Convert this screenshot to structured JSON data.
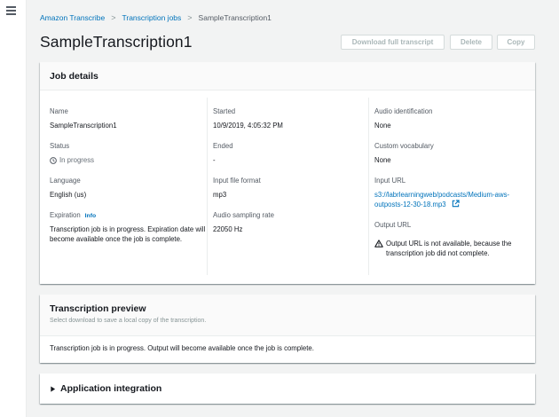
{
  "breadcrumb": {
    "items": [
      "Amazon Transcribe",
      "Transcription jobs"
    ],
    "current": "SampleTranscription1",
    "separator": ">"
  },
  "page": {
    "title": "SampleTranscription1"
  },
  "actions": {
    "download": "Download full transcript",
    "delete": "Delete",
    "copy": "Copy"
  },
  "job_details": {
    "heading": "Job details",
    "name": {
      "label": "Name",
      "value": "SampleTranscription1"
    },
    "status": {
      "label": "Status",
      "value": "In progress"
    },
    "language": {
      "label": "Language",
      "value": "English (us)"
    },
    "expiration": {
      "label": "Expiration",
      "info": "Info",
      "value": "Transcription job is in progress. Expiration date will become available once the job is complete."
    },
    "started": {
      "label": "Started",
      "value": "10/9/2019, 4:05:32 PM"
    },
    "ended": {
      "label": "Ended",
      "value": "-"
    },
    "input_format": {
      "label": "Input file format",
      "value": "mp3"
    },
    "sampling_rate": {
      "label": "Audio sampling rate",
      "value": "22050 Hz"
    },
    "audio_identification": {
      "label": "Audio identification",
      "value": "None"
    },
    "custom_vocabulary": {
      "label": "Custom vocabulary",
      "value": "None"
    },
    "input_url": {
      "label": "Input URL",
      "line1": "s3://labrlearningweb/podcasts/Medium-aws-",
      "line2": "outposts-12-30-18.mp3"
    },
    "output_url": {
      "label": "Output URL",
      "value": "Output URL is not available, because the transcription job did not complete."
    }
  },
  "preview": {
    "heading": "Transcription preview",
    "subtitle": "Select download to save a local copy of the transcription.",
    "body": "Transcription job is in progress. Output will become available once the job is complete."
  },
  "application_integration": {
    "heading": "Application integration"
  },
  "icons": {
    "menu": "hamburger-icon",
    "status": "clock-icon",
    "external": "external-link-icon",
    "warning": "warning-icon",
    "expand": "caret-right-icon"
  },
  "colors": {
    "link": "#0073bb",
    "background": "#f2f3f3",
    "disabled_text": "#aab7b8"
  }
}
